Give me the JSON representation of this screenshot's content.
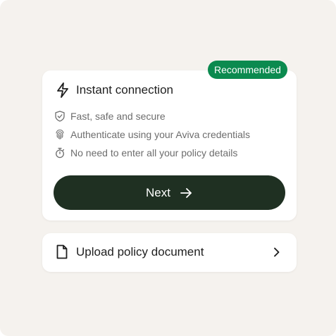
{
  "badge": {
    "label": "Recommended"
  },
  "instant": {
    "title": "Instant connection",
    "features": [
      {
        "icon": "shield-check-icon",
        "text": "Fast, safe and secure"
      },
      {
        "icon": "fingerprint-icon",
        "text": "Authenticate using your Aviva credentials"
      },
      {
        "icon": "stopwatch-icon",
        "text": "No need to enter all your policy details"
      }
    ],
    "button_label": "Next"
  },
  "upload": {
    "label": "Upload policy document",
    "icon": "document-icon"
  },
  "colors": {
    "background": "#f5f2ee",
    "card": "#ffffff",
    "badge": "#0b8a4f",
    "button": "#1f3022",
    "text_primary": "#1f1f1f",
    "text_secondary": "#6d6d6d"
  }
}
